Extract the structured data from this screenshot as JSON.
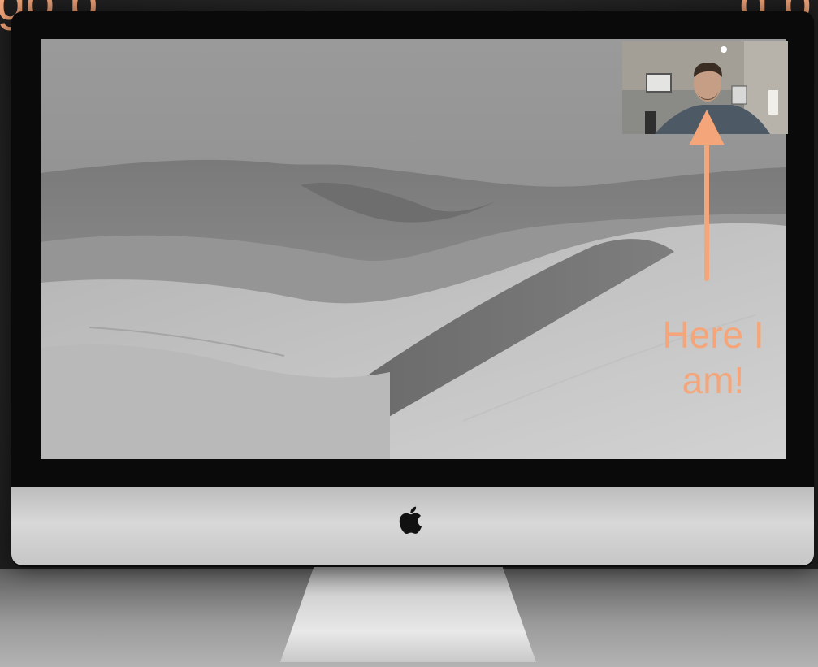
{
  "caption": {
    "top_left": "go p",
    "top_right": "g p"
  },
  "callout": {
    "line1": "Here I",
    "line2": "am!",
    "color": "#f4a67a"
  },
  "icons": {
    "logo": "apple-logo-icon",
    "arrow": "arrow-up-icon"
  },
  "colors": {
    "accent": "#f4a67a",
    "bezel": "#0a0a0a",
    "chin": "#d0d0d0"
  }
}
